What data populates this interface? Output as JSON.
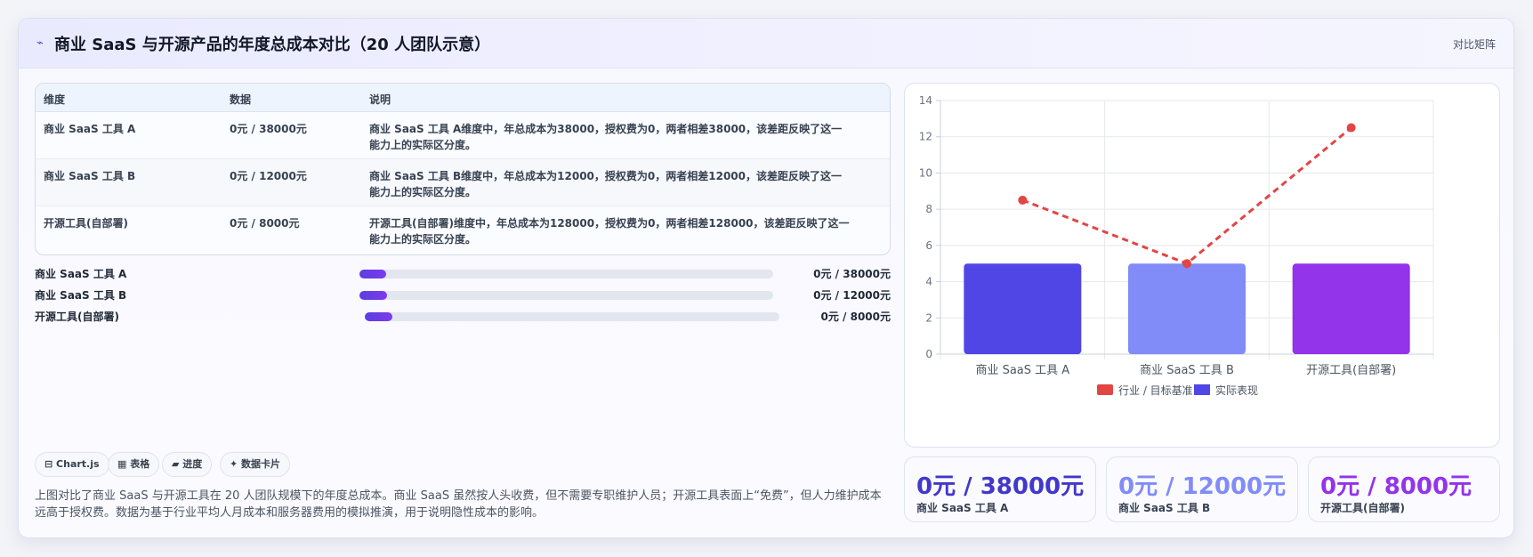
{
  "header": {
    "icon": "chart-line-icon",
    "title": "商业 SaaS 与开源产品的年度总成本对比（20 人团队示意）",
    "view_label": "对比矩阵"
  },
  "table": {
    "headers": [
      "维度",
      "数据",
      "说明"
    ],
    "rows": [
      {
        "dim": "商业 SaaS 工具 A",
        "data": "0元 / 38000元",
        "desc": "商业 SaaS 工具 A维度中，年总成本为38000，授权费为0，两者相差38000，该差距反映了这一能力上的实际区分度。"
      },
      {
        "dim": "商业 SaaS 工具 B",
        "data": "0元 / 12000元",
        "desc": "商业 SaaS 工具 B维度中，年总成本为12000，授权费为0，两者相差12000，该差距反映了这一能力上的实际区分度。"
      },
      {
        "dim": "开源工具(自部署)",
        "data": "0元 / 8000元",
        "desc": "开源工具(自部署)维度中，年总成本为128000，授权费为0，两者相差128000，该差距反映了这一能力上的实际区分度。"
      }
    ]
  },
  "progress": [
    {
      "label": "商业 SaaS 工具 A",
      "value_text": "0元 / 38000元",
      "fraction": 0.065
    },
    {
      "label": "商业 SaaS 工具 B",
      "value_text": "0元 / 12000元",
      "fraction": 0.067
    },
    {
      "label": "开源工具(自部署)",
      "value_text": "0元 / 8000元",
      "fraction": 0.067
    }
  ],
  "chips": [
    {
      "icon": "chart-icon",
      "label": "Chart.js"
    },
    {
      "icon": "table-icon",
      "label": "表格"
    },
    {
      "icon": "progress-icon",
      "label": "进度"
    },
    {
      "icon": "sparkle-icon",
      "label": "数据卡片"
    }
  ],
  "chips_text": [
    "⊟ Chart.js",
    "▦ 表格",
    "▰ 进度",
    "✦ 数据卡片"
  ],
  "note": "上图对比了商业 SaaS 与开源工具在 20 人团队规模下的年度总成本。商业 SaaS 虽然按人头收费，但不需要专职维护人员；开源工具表面上“免费”，但人力维护成本远高于授权费。数据为基于行业平均人月成本和服务器费用的模拟推演，用于说明隐性成本的影响。",
  "chart_data": {
    "type": "bar",
    "categories": [
      "商业 SaaS 工具 A",
      "商业 SaaS 工具 B",
      "开源工具(自部署)"
    ],
    "ylim": [
      0,
      14
    ],
    "yticks": [
      0,
      2,
      4,
      6,
      8,
      10,
      12,
      14
    ],
    "grid": true,
    "legend_position": "bottom",
    "series": [
      {
        "name": "行业 / 目标基准",
        "kind": "line-dashed",
        "values": [
          8.5,
          5,
          12.5
        ],
        "color": "#e34545"
      },
      {
        "name": "实际表现",
        "kind": "bar",
        "values": [
          5,
          5,
          5
        ],
        "colors": [
          "#4f46e5",
          "#818cf8",
          "#9333ea"
        ]
      }
    ]
  },
  "kpis": [
    {
      "value": "0元 / 38000元",
      "label": "商业 SaaS 工具 A",
      "color": "#4338ca"
    },
    {
      "value": "0元 / 12000元",
      "label": "商业 SaaS 工具 B",
      "color": "#818cf8"
    },
    {
      "value": "0元 / 8000元",
      "label": "开源工具(自部署)",
      "color": "#9333ea"
    }
  ]
}
